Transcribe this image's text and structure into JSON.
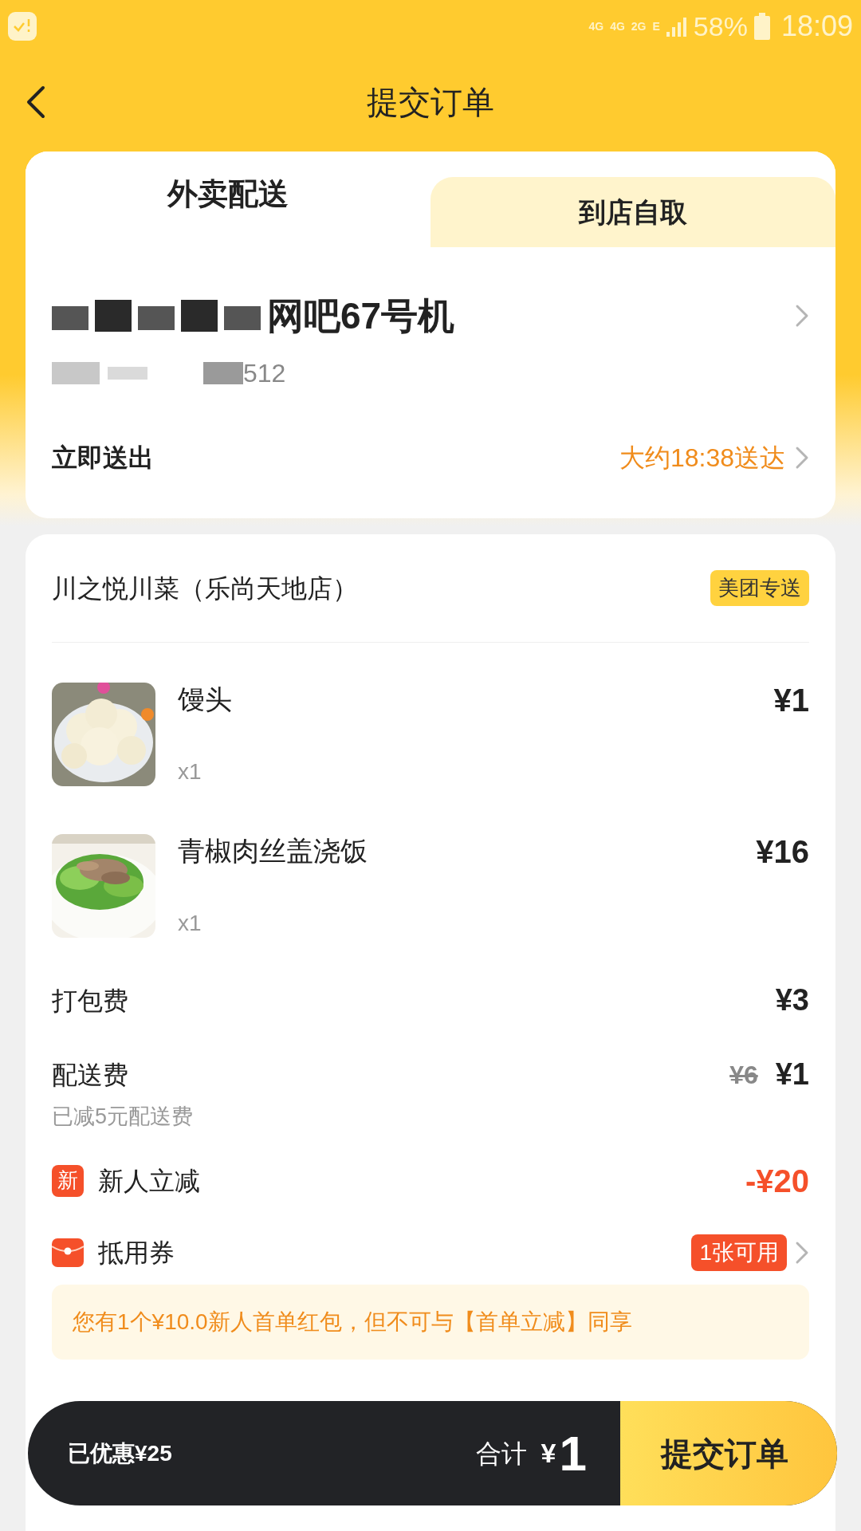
{
  "status_bar": {
    "network": [
      "4G",
      "4G",
      "2G",
      "E"
    ],
    "battery": "58%",
    "time": "18:09"
  },
  "header": {
    "title": "提交订单"
  },
  "tabs": [
    {
      "label": "外卖配送",
      "selected": true
    },
    {
      "label": "到店自取",
      "selected": false
    }
  ],
  "address": {
    "name": "网吧67号机",
    "phone": "512"
  },
  "delivery_time": {
    "label": "立即送出",
    "eta": "大约18:38送达"
  },
  "store": {
    "name": "川之悦川菜（乐尚天地店）",
    "badge": "美团专送"
  },
  "items": [
    {
      "name": "馒头",
      "quantity": "x1",
      "price": "¥1",
      "kind": "buns"
    },
    {
      "name": "青椒肉丝盖浇饭",
      "quantity": "x1",
      "price": "¥16",
      "kind": "rice"
    }
  ],
  "packing_fee": {
    "label": "打包费",
    "price": "¥3"
  },
  "delivery_fee": {
    "label": "配送费",
    "original": "¥6",
    "price": "¥1",
    "note": "已减5元配送费"
  },
  "discounts": [
    {
      "kind": "new",
      "icon_text": "新",
      "label": "新人立减",
      "value": "-¥20"
    },
    {
      "kind": "coupon",
      "label": "抵用券",
      "badge": "1张可用"
    }
  ],
  "notice": "您有1个¥10.0新人首单红包，但不可与【首单立减】同享",
  "bottom_bar": {
    "saved": "已优惠¥25",
    "total_label": "合计",
    "currency": "¥",
    "total": "1",
    "submit": "提交订单"
  }
}
